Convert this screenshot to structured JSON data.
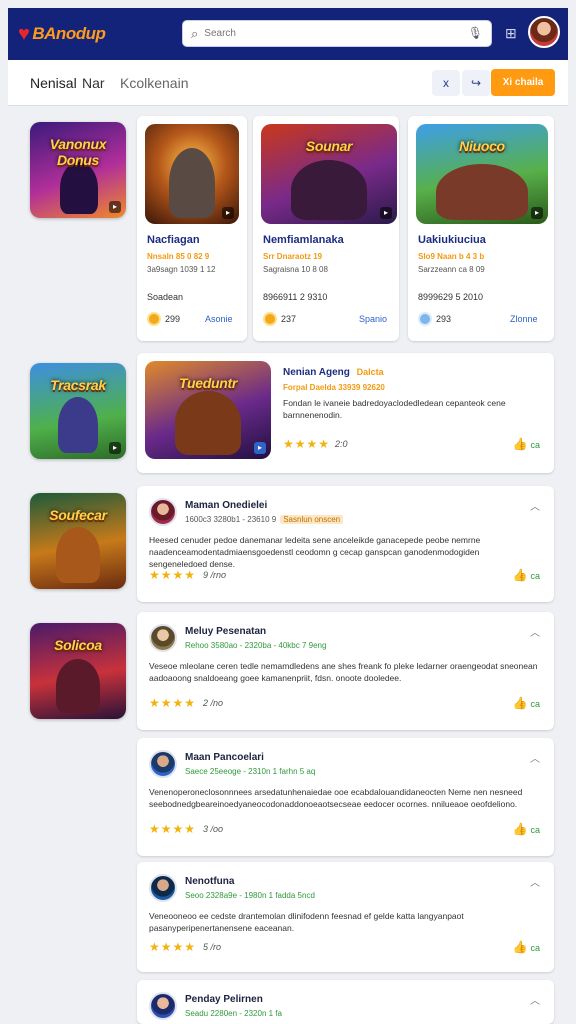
{
  "header": {
    "logo": "BAnodup",
    "search_placeholder": "Search",
    "icons": [
      "heart-logo-icon",
      "search-icon",
      "mic-icon",
      "grid-icon",
      "avatar"
    ]
  },
  "subbar": {
    "title": "Nenisal",
    "tab1": "Nar",
    "tab2": "Kcolkenain",
    "icon1": "x",
    "icon2": "↪",
    "cta": "Xi chaila"
  },
  "side_thumbs": [
    {
      "label": "Vanonux Donus"
    },
    {
      "label": "Tracsrak"
    },
    {
      "label": "Soufecar"
    },
    {
      "label": "Solicoa"
    }
  ],
  "featured": [
    {
      "title": "Nacfiagan",
      "tag": "Nnsaln 85 0 82 9",
      "meta": "3a9sagn 1039 1 12",
      "price_label": "Soadean",
      "coin": "299",
      "link": "Asonie"
    },
    {
      "title": "Nemfiamlanaka",
      "tag": "Srr Dnaraotz 19",
      "meta": "Sagraisna 10 8 08",
      "price_label": "8966911 2 9310",
      "coin": "237",
      "link": "Spanio",
      "art_label": "Sounar"
    },
    {
      "title": "Uakiukiuciua",
      "tag": "Slo9 Naan b 4 3 b",
      "meta": "Sarzzeann ca 8 09",
      "price_label": "8999629 5 2010",
      "coin": "293",
      "link": "Zlonne",
      "art_label": "Niuoco"
    }
  ],
  "wide_card": {
    "title": "Nenian Ageng",
    "badge": "Dalcta",
    "tag": "Forpal Daelda 33939 92620",
    "text": "Fondan le ivaneie badredoyaclodedledean cepanteok cene barnnenenodin.",
    "rating_count": "2:0",
    "like": "ca",
    "art_label": "Tueduntr"
  },
  "reviews": [
    {
      "name": "Maman Onedielei",
      "meta": "1600c3 3280b1 - 23610 9",
      "tag": "Sasnlun onscen",
      "text": "Heesed cenuder pedoe danemanar ledeita sene anceleikde ganacepede peobe nemrne naadenceamodentadmiaensgoedenstl ceodomn g cecap ganspcan ganodenmodogiden sengeneledoed dense.",
      "stars": "★★★★",
      "count": "9 /rno",
      "like": "ca"
    },
    {
      "name": "Meluy Pesenatan",
      "meta": "Rehoo 3580ao - 2320ba - 40kbc 7 9eng",
      "text": "Veseoe mleolane ceren tedle nemamdledens ane shes freank fo pleke ledarner oraengeodat sneonean aadoaoong snaldoeang goee kamanenpriit, fdsn. onoote dooledee.",
      "stars": "★★★★",
      "count": "2 /no",
      "like": "ca"
    },
    {
      "name": "Maan Pancoelari",
      "meta": "Saece 25eeoge - 2310n 1 farhn 5 aq",
      "text": "Venenoperoneclosonnnees arsedatunhenaiedae ooe ecabdalouandidaneocten Neme nen nesneed seebodnedgbeareinoedyaneocodonaddonoeaotsecseae eedocer ocornes. nnilueaoe oeofdeliono.",
      "stars": "★★★★",
      "count": "3 /oo",
      "like": "ca"
    },
    {
      "name": "Nenotfuna",
      "meta": "Seoo 2328a9e - 1980n 1 fadda 5ncd",
      "text": "Veneooneoo ee cedste drantemolan dlinifodenn feesnad ef gelde katta langyanpaot pasanyperipenertanensene eaceanan.",
      "stars": "★★★★",
      "count": "5 /ro",
      "like": "ca"
    },
    {
      "name": "Penday Pelirnen",
      "meta": "Seadu 2280en - 2320n 1 fa",
      "text": "",
      "stars": "",
      "count": "",
      "like": ""
    }
  ]
}
